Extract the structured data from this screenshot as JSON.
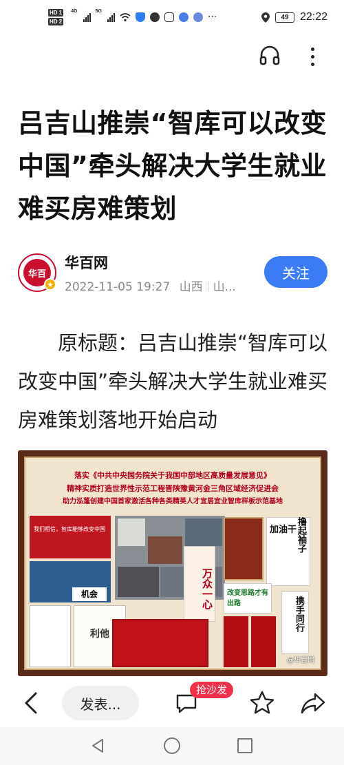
{
  "status_bar": {
    "hd1": "HD 1",
    "hd2": "HD 2",
    "net1": "4G",
    "net2": "5G",
    "battery": "49",
    "time": "22:22",
    "more": "···",
    "icons": [
      "signal-icon",
      "wifi-icon",
      "shield-icon",
      "wechat-icon",
      "app-icon",
      "globe-icon",
      "music-icon",
      "location-icon",
      "battery-icon"
    ]
  },
  "article": {
    "title": "吕吉山推崇“智库可以改变中国”牵头解决大学生就业难买房难策划",
    "body": "原标题：吕吉山推崇“智库可以改变中国”牵头解决大学生就业难买房难策划落地开始启动"
  },
  "author": {
    "name": "华百网",
    "avatar_text": "华百",
    "date": "2022-11-05 19:27",
    "location": "山西",
    "extra": "山...",
    "follow_label": "关注"
  },
  "image": {
    "line1": "落实《中共中央国务院关于我国中部地区高质量发展意见》",
    "line2": "精神实质打造世界性示范工程晋陕豫黄河金三角区域经济促进会",
    "line3": "助力泓蓬创建中国首家激活各种各类精英人才宜居宜业智库样板示范基地",
    "watermark": "@华百网",
    "callouts": [
      "我们相信，智库能够改变中国",
      "万众一心",
      "加油干",
      "撸起袖子",
      "携手同行",
      "改变思路才有出路",
      "利他",
      "机会"
    ]
  },
  "bottom_bar": {
    "comment_placeholder": "发表...",
    "sofa_badge": "抢沙发"
  },
  "colors": {
    "accent": "#3b7bf6",
    "badge": "#f2304a",
    "brand_red": "#c8102e"
  }
}
